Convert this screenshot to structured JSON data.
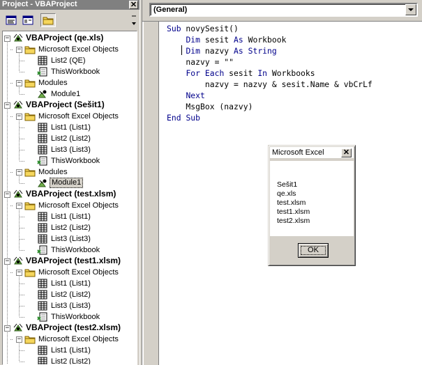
{
  "project_pane": {
    "title": "Project - VBAProject",
    "close_glyph": "✕",
    "toolbar": {
      "view_code_icon": "view-code-icon",
      "view_object_icon": "view-object-icon",
      "toggle_folders_icon": "folder-icon"
    },
    "tree": [
      {
        "label": "VBAProject (qe.xls)",
        "level": 0,
        "type": "project",
        "toggle": "−"
      },
      {
        "label": "Microsoft Excel Objects",
        "level": 1,
        "type": "folder",
        "toggle": "−"
      },
      {
        "label": "List2 (QE)",
        "level": 2,
        "type": "sheet"
      },
      {
        "label": "ThisWorkbook",
        "level": 2,
        "type": "workbook"
      },
      {
        "label": "Modules",
        "level": 1,
        "type": "folder",
        "toggle": "−"
      },
      {
        "label": "Module1",
        "level": 2,
        "type": "module"
      },
      {
        "label": "VBAProject (Sešit1)",
        "level": 0,
        "type": "project",
        "toggle": "−"
      },
      {
        "label": "Microsoft Excel Objects",
        "level": 1,
        "type": "folder",
        "toggle": "−"
      },
      {
        "label": "List1 (List1)",
        "level": 2,
        "type": "sheet"
      },
      {
        "label": "List2 (List2)",
        "level": 2,
        "type": "sheet"
      },
      {
        "label": "List3 (List3)",
        "level": 2,
        "type": "sheet"
      },
      {
        "label": "ThisWorkbook",
        "level": 2,
        "type": "workbook"
      },
      {
        "label": "Modules",
        "level": 1,
        "type": "folder",
        "toggle": "−"
      },
      {
        "label": "Module1",
        "level": 2,
        "type": "module",
        "selected": true
      },
      {
        "label": "VBAProject (test.xlsm)",
        "level": 0,
        "type": "project",
        "toggle": "−"
      },
      {
        "label": "Microsoft Excel Objects",
        "level": 1,
        "type": "folder",
        "toggle": "−"
      },
      {
        "label": "List1 (List1)",
        "level": 2,
        "type": "sheet"
      },
      {
        "label": "List2 (List2)",
        "level": 2,
        "type": "sheet"
      },
      {
        "label": "List3 (List3)",
        "level": 2,
        "type": "sheet"
      },
      {
        "label": "ThisWorkbook",
        "level": 2,
        "type": "workbook"
      },
      {
        "label": "VBAProject (test1.xlsm)",
        "level": 0,
        "type": "project",
        "toggle": "−"
      },
      {
        "label": "Microsoft Excel Objects",
        "level": 1,
        "type": "folder",
        "toggle": "−"
      },
      {
        "label": "List1 (List1)",
        "level": 2,
        "type": "sheet"
      },
      {
        "label": "List2 (List2)",
        "level": 2,
        "type": "sheet"
      },
      {
        "label": "List3 (List3)",
        "level": 2,
        "type": "sheet"
      },
      {
        "label": "ThisWorkbook",
        "level": 2,
        "type": "workbook"
      },
      {
        "label": "VBAProject (test2.xlsm)",
        "level": 0,
        "type": "project",
        "toggle": "−"
      },
      {
        "label": "Microsoft Excel Objects",
        "level": 1,
        "type": "folder",
        "toggle": "−"
      },
      {
        "label": "List1 (List1)",
        "level": 2,
        "type": "sheet"
      },
      {
        "label": "List2 (List2)",
        "level": 2,
        "type": "sheet"
      }
    ]
  },
  "code_pane": {
    "object_dropdown": "(General)",
    "code_lines": [
      [
        {
          "t": "Sub",
          "k": true
        },
        {
          "t": " novySesit()"
        }
      ],
      [
        {
          "t": "    "
        },
        {
          "t": "Dim",
          "k": true
        },
        {
          "t": " sesit "
        },
        {
          "t": "As",
          "k": true
        },
        {
          "t": " Workbook"
        }
      ],
      [
        {
          "t": "    "
        },
        {
          "t": "Dim",
          "k": true
        },
        {
          "t": " nazvy "
        },
        {
          "t": "As",
          "k": true
        },
        {
          "t": " "
        },
        {
          "t": "String",
          "k": true
        }
      ],
      [
        {
          "t": "    nazvy = \"\""
        }
      ],
      [
        {
          "t": "    "
        },
        {
          "t": "For",
          "k": true
        },
        {
          "t": " "
        },
        {
          "t": "Each",
          "k": true
        },
        {
          "t": " sesit "
        },
        {
          "t": "In",
          "k": true
        },
        {
          "t": " Workbooks"
        }
      ],
      [
        {
          "t": "        nazvy = nazvy & sesit.Name & vbCrLf"
        }
      ],
      [
        {
          "t": "    "
        },
        {
          "t": "Next",
          "k": true
        }
      ],
      [
        {
          "t": "    MsgBox (nazvy)"
        }
      ],
      [
        {
          "t": "End",
          "k": true
        },
        {
          "t": " "
        },
        {
          "t": "Sub",
          "k": true
        }
      ]
    ]
  },
  "msgbox": {
    "title": "Microsoft Excel",
    "close_glyph": "✕",
    "lines": [
      "Sešit1",
      "qe.xls",
      "test.xlsm",
      "test1.xlsm",
      "test2.xlsm"
    ],
    "ok_label": "OK"
  },
  "colors": {
    "keyword": "#00008b",
    "title_inactive": "#808080",
    "face": "#d4d0c8"
  }
}
